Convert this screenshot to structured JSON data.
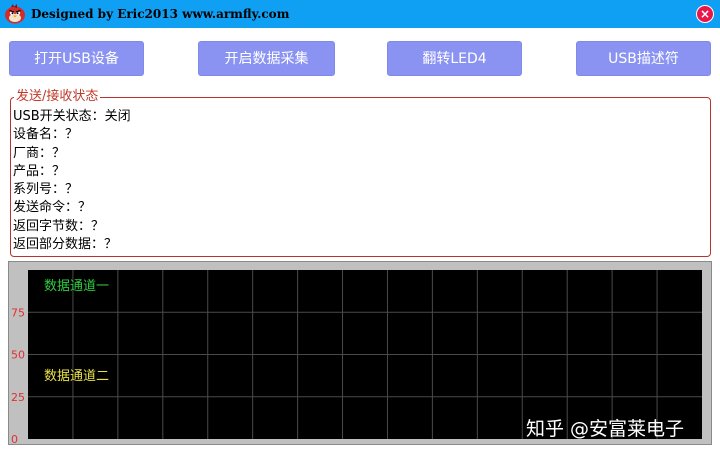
{
  "window": {
    "title": "Designed by Eric2013  www.armfly.com",
    "close_glyph": "×",
    "titlebar_color": "#0f9ff3",
    "close_color": "#e8174a",
    "app_icon": "angry-bird-icon"
  },
  "toolbar": {
    "open_usb": "打开USB设备",
    "start_acquisition": "开启数据采集",
    "toggle_led": "翻转LED4",
    "usb_descriptor": "USB描述符",
    "button_color": "#8b93f2"
  },
  "status_group": {
    "title": "发送/接收状态",
    "lines": [
      "USB开关状态：关闭",
      "设备名：？",
      "厂商：？",
      "产品：？",
      "系列号：？",
      "发送命令：？",
      "返回字节数：？",
      "返回部分数据：？"
    ]
  },
  "chart_data": {
    "type": "line",
    "y_ticks": [
      "75",
      "50",
      "25",
      "0"
    ],
    "ylim": [
      0,
      100
    ],
    "grid": true,
    "background": "#000000",
    "series": [
      {
        "name": "数据通道一",
        "color": "#2ecc40",
        "values": []
      },
      {
        "name": "数据通道二",
        "color": "#e8e04a",
        "values": []
      }
    ]
  },
  "watermark": "知乎 @安富莱电子"
}
